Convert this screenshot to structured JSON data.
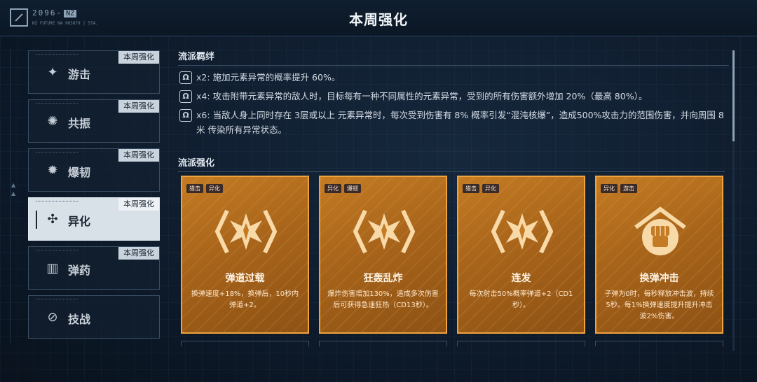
{
  "header": {
    "title": "本周强化",
    "logo_code": "2096-",
    "logo_tag": "NZ",
    "logo_sub": "NZ FUTURE NA 963879 | STA."
  },
  "sidebar": {
    "tag": "本周强化",
    "items": [
      {
        "label": "游击",
        "icon": "guerrilla-icon",
        "glyph": "✦"
      },
      {
        "label": "共振",
        "icon": "resonance-icon",
        "glyph": "✺"
      },
      {
        "label": "爆韧",
        "icon": "burst-icon",
        "glyph": "✹"
      },
      {
        "label": "异化",
        "icon": "mutation-icon",
        "glyph": "✣",
        "active": true
      },
      {
        "label": "弹药",
        "icon": "ammo-icon",
        "glyph": "▥"
      },
      {
        "label": "技战",
        "icon": "tactics-icon",
        "glyph": "⊘"
      }
    ]
  },
  "bonds": {
    "title": "流派羁绊",
    "items": [
      {
        "count": "x2:",
        "text": "施加元素异常的概率提升 60%。"
      },
      {
        "count": "x4:",
        "text": "攻击附带元素异常的敌人时，目标每有一种不同属性的元素异常，受到的所有伤害额外增加 20%（最高 80%）。"
      },
      {
        "count": "x6:",
        "text": "当敌人身上同时存在 3层或以上 元素异常时，每次受到伤害有 8% 概率引发“混沌核爆”，造成500%攻击力的范围伤害，并向周围 8米 传染所有异常状态。"
      }
    ]
  },
  "enhance": {
    "title": "流派强化",
    "cards": [
      {
        "tags": [
          "猎击",
          "异化"
        ],
        "name": "弹道过载",
        "desc": "换弹速度+18%，换弹后，10秒内弹道+2。",
        "emblem": "star-emblem-icon"
      },
      {
        "tags": [
          "异化",
          "爆韧"
        ],
        "name": "狂轰乱炸",
        "desc": "爆炸伤害增加130%，造成多次伤害后可获得急速狂热（CD13秒）。",
        "emblem": "star-emblem-icon"
      },
      {
        "tags": [
          "猎击",
          "异化"
        ],
        "name": "连发",
        "desc": "每次射击50%概率弹道+2（CD1秒）。",
        "emblem": "star-emblem-icon"
      },
      {
        "tags": [
          "异化",
          "游击"
        ],
        "name": "换弹冲击",
        "desc": "子弹为0时，每秒释放冲击波，持续5秒。每1%换弹速度提升提升冲击波2%伤害。",
        "emblem": "fist-emblem-icon"
      }
    ]
  },
  "colors": {
    "accent": "#f0a23c",
    "card_bg": "#b06b1d",
    "bg": "#0d1a2a"
  }
}
